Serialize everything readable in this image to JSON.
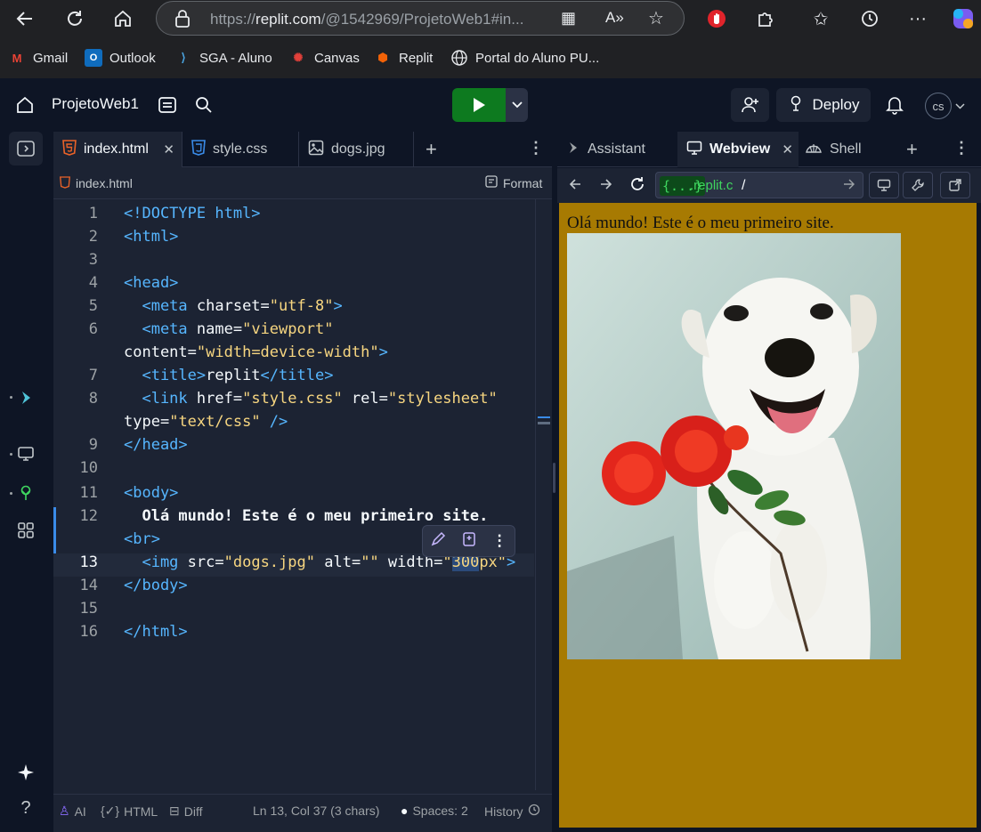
{
  "browser": {
    "url_prefix": "https://",
    "url_host": "replit.com",
    "url_rest": "/@1542969/ProjetoWeb1#in...",
    "bookmarks": [
      {
        "label": "Gmail"
      },
      {
        "label": "Outlook"
      },
      {
        "label": "SGA - Aluno"
      },
      {
        "label": "Canvas"
      },
      {
        "label": "Replit"
      },
      {
        "label": "Portal do Aluno PU..."
      }
    ]
  },
  "header": {
    "project_name": "ProjetoWeb1",
    "deploy_label": "Deploy",
    "avatar_initials": "cs"
  },
  "editor": {
    "tabs": [
      {
        "label": "index.html"
      },
      {
        "label": "style.css"
      },
      {
        "label": "dogs.jpg"
      }
    ],
    "file_path": "index.html",
    "format_label": "Format",
    "lines": [
      {
        "n": "1"
      },
      {
        "n": "2"
      },
      {
        "n": "3"
      },
      {
        "n": "4"
      },
      {
        "n": "5"
      },
      {
        "n": "6"
      },
      {
        "n": "7"
      },
      {
        "n": "8"
      },
      {
        "n": "9"
      },
      {
        "n": "10"
      },
      {
        "n": "11"
      },
      {
        "n": "12"
      },
      {
        "n": "13"
      },
      {
        "n": "14"
      },
      {
        "n": "15"
      },
      {
        "n": "16"
      }
    ],
    "code": {
      "l1": "<!DOCTYPE html>",
      "l2": "<html>",
      "l4": "<head>",
      "l5a": "  <meta ",
      "l5b": "charset",
      "l5c": "=",
      "l5d": "\"utf-8\"",
      "l5e": ">",
      "l6a": "  <meta ",
      "l6b": "name",
      "l6c": "=",
      "l6d": "\"viewport\"",
      "l6w_a": "content",
      "l6w_b": "=",
      "l6w_c": "\"width=device-width\"",
      "l6w_d": ">",
      "l7a": "  <title>",
      "l7b": "replit",
      "l7c": "</title>",
      "l8a": "  <link ",
      "l8b": "href",
      "l8c": "=",
      "l8d": "\"style.css\"",
      "l8e": " rel",
      "l8f": "=",
      "l8g": "\"stylesheet\"",
      "l8w_a": "type",
      "l8w_b": "=",
      "l8w_c": "\"text/css\"",
      "l8w_d": " />",
      "l9": "</head>",
      "l11": "<body>",
      "l12": "  Olá mundo! Este é o meu primeiro site.",
      "l12w": "<br>",
      "l13a": "  <img ",
      "l13b": "src",
      "l13c": "=",
      "l13d": "\"dogs.jpg\"",
      "l13e": " alt",
      "l13f": "=",
      "l13g": "\"\"",
      "l13h": " width",
      "l13i": "=",
      "l13j": "\"",
      "l13k": "300",
      "l13l": "px\"",
      "l13m": ">",
      "l14": "</body>",
      "l16": "</html>"
    },
    "status": {
      "ai": "AI",
      "lang": "HTML",
      "diff": "Diff",
      "position": "Ln 13, Col 37 (3 chars)",
      "spaces": "Spaces: 2",
      "history": "History"
    }
  },
  "right_pane": {
    "tabs": [
      {
        "label": "Assistant"
      },
      {
        "label": "Webview"
      },
      {
        "label": "Shell"
      }
    ],
    "webview": {
      "host_badge": "{...}",
      "host": ".replit.c",
      "path": "/",
      "page_text": "Olá mundo! Este é o meu primeiro site."
    }
  },
  "colors": {
    "accent_run": "#0d7a1f",
    "page_bg": "#a77a02",
    "tag": "#56b6ff",
    "string": "#f7d680"
  }
}
